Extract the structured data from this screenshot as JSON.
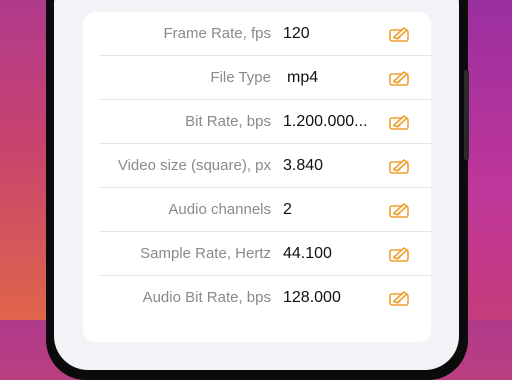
{
  "accent_color": "#f0a030",
  "rows": [
    {
      "label": "Frame Rate, fps",
      "value": "120",
      "icon": "edit-pencil-icon"
    },
    {
      "label": "File Type",
      "value": "mp4",
      "icon": "edit-pencil-icon"
    },
    {
      "label": "Bit Rate, bps",
      "value": "1.200.000...",
      "icon": "edit-pencil-icon"
    },
    {
      "label": "Video size (square), px",
      "value": "3.840",
      "icon": "edit-pencil-icon"
    },
    {
      "label": "Audio channels",
      "value": "2",
      "icon": "edit-pencil-icon"
    },
    {
      "label": "Sample Rate, Hertz",
      "value": "44.100",
      "icon": "edit-pencil-icon"
    },
    {
      "label": "Audio Bit Rate, bps",
      "value": "128.000",
      "icon": "edit-pencil-icon"
    }
  ]
}
